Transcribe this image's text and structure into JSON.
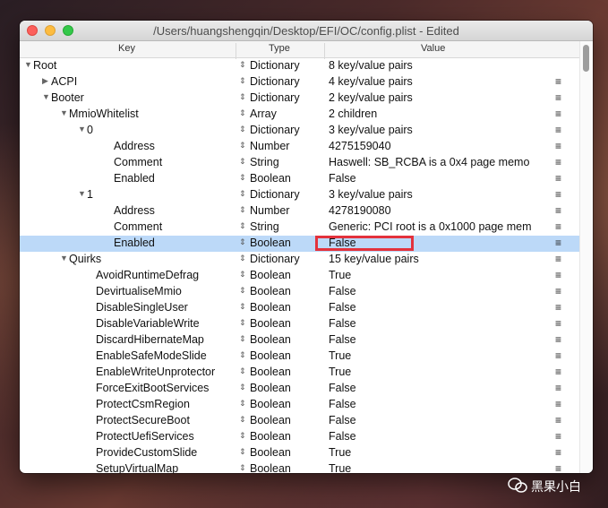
{
  "window": {
    "title": "/Users/huangshengqin/Desktop/EFI/OC/config.plist - Edited"
  },
  "columns": {
    "key": "Key",
    "type": "Type",
    "value": "Value"
  },
  "rows": [
    {
      "key": "Root",
      "type": "Dictionary",
      "value": "8 key/value pairs",
      "disclosure": "expanded",
      "menu": false
    },
    {
      "key": "ACPI",
      "type": "Dictionary",
      "value": "4 key/value pairs",
      "disclosure": "collapsed",
      "menu": true
    },
    {
      "key": "Booter",
      "type": "Dictionary",
      "value": "2 key/value pairs",
      "disclosure": "expanded",
      "menu": true
    },
    {
      "key": "MmioWhitelist",
      "type": "Array",
      "value": "2 children",
      "disclosure": "expanded",
      "menu": true
    },
    {
      "key": "0",
      "type": "Dictionary",
      "value": "3 key/value pairs",
      "disclosure": "expanded",
      "menu": true
    },
    {
      "key": "Address",
      "type": "Number",
      "value": "4275159040",
      "disclosure": "none",
      "menu": true
    },
    {
      "key": "Comment",
      "type": "String",
      "value": "Haswell: SB_RCBA is a 0x4 page memo",
      "disclosure": "none",
      "menu": true
    },
    {
      "key": "Enabled",
      "type": "Boolean",
      "value": "False",
      "disclosure": "none",
      "menu": true
    },
    {
      "key": "1",
      "type": "Dictionary",
      "value": "3 key/value pairs",
      "disclosure": "expanded",
      "menu": true
    },
    {
      "key": "Address",
      "type": "Number",
      "value": "4278190080",
      "disclosure": "none",
      "menu": true
    },
    {
      "key": "Comment",
      "type": "String",
      "value": "Generic: PCI root is a 0x1000 page mem",
      "disclosure": "none",
      "menu": true
    },
    {
      "key": "Enabled",
      "type": "Boolean",
      "value": "False",
      "disclosure": "none",
      "menu": true,
      "selected": true
    },
    {
      "key": "Quirks",
      "type": "Dictionary",
      "value": "15 key/value pairs",
      "disclosure": "expanded",
      "menu": true
    },
    {
      "key": "AvoidRuntimeDefrag",
      "type": "Boolean",
      "value": "True",
      "disclosure": "none",
      "menu": true
    },
    {
      "key": "DevirtualiseMmio",
      "type": "Boolean",
      "value": "False",
      "disclosure": "none",
      "menu": true
    },
    {
      "key": "DisableSingleUser",
      "type": "Boolean",
      "value": "False",
      "disclosure": "none",
      "menu": true
    },
    {
      "key": "DisableVariableWrite",
      "type": "Boolean",
      "value": "False",
      "disclosure": "none",
      "menu": true
    },
    {
      "key": "DiscardHibernateMap",
      "type": "Boolean",
      "value": "False",
      "disclosure": "none",
      "menu": true
    },
    {
      "key": "EnableSafeModeSlide",
      "type": "Boolean",
      "value": "True",
      "disclosure": "none",
      "menu": true
    },
    {
      "key": "EnableWriteUnprotector",
      "type": "Boolean",
      "value": "True",
      "disclosure": "none",
      "menu": true
    },
    {
      "key": "ForceExitBootServices",
      "type": "Boolean",
      "value": "False",
      "disclosure": "none",
      "menu": true
    },
    {
      "key": "ProtectCsmRegion",
      "type": "Boolean",
      "value": "False",
      "disclosure": "none",
      "menu": true
    },
    {
      "key": "ProtectSecureBoot",
      "type": "Boolean",
      "value": "False",
      "disclosure": "none",
      "menu": true
    },
    {
      "key": "ProtectUefiServices",
      "type": "Boolean",
      "value": "False",
      "disclosure": "none",
      "menu": true
    },
    {
      "key": "ProvideCustomSlide",
      "type": "Boolean",
      "value": "True",
      "disclosure": "none",
      "menu": true
    },
    {
      "key": "SetupVirtualMap",
      "type": "Boolean",
      "value": "True",
      "disclosure": "none",
      "menu": true
    }
  ],
  "icons": {
    "type_stepper": "⇕",
    "row_menu": "≡",
    "expanded": "▼",
    "collapsed": "▶"
  },
  "watermark": {
    "text": "黑果小白"
  },
  "colors": {
    "selection": "#bcd9f8",
    "highlight_box": "#e3323c"
  }
}
